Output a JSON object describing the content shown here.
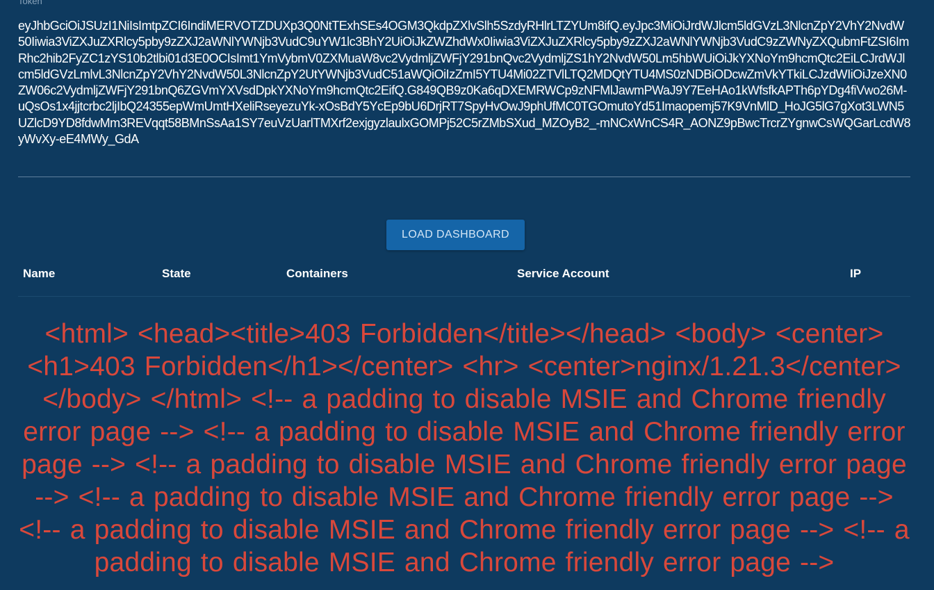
{
  "token": {
    "label": "Token",
    "value": "eyJhbGciOiJSUzI1NiIsImtpZCI6IndiMERVOTZDUXp3Q0NtTExhSEs4OGM3QkdpZXlvSlh5SzdyRHlrLTZYUm8ifQ.eyJpc3MiOiJrdWJlcm5ldGVzL3NlcnZpY2VhY2NvdW50Iiwia3ViZXJuZXRlcy5pby9zZXJ2aWNlYWNjb3VudC9uYW1lc3BhY2UiOiJkZWZhdWx0Iiwia3ViZXJuZXRlcy5pby9zZXJ2aWNlYWNjb3VudC9zZWNyZXQubmFtZSI6ImRhc2hib2FyZC1zYS10b2tlbi01d3E0OCIsImt1YmVybmV0ZXMuaW8vc2VydmljZWFjY291bnQvc2VydmljZS1hY2NvdW50Lm5hbWUiOiJkYXNoYm9hcmQtc2EiLCJrdWJlcm5ldGVzLmlvL3NlcnZpY2VhY2NvdW50L3NlcnZpY2UtYWNjb3VudC51aWQiOiIzZmI5YTU4Mi02ZTVlLTQ2MDQtYTU4MS0zNDBiODcwZmVkYTkiLCJzdWIiOiJzeXN0ZW06c2VydmljZWFjY291bnQ6ZGVmYXVsdDpkYXNoYm9hcmQtc2EifQ.G849QB9z0Ka6qDXEMRWCp9zNFMlJawmPWaJ9Y7EeHAo1kWfsfkAPTh6pYDg4fiVwo26M-uQsOs1x4jjtcrbc2ljIbQ24355epWmUmtHXeliRseyezuYk-xOsBdY5YcEp9bU6DrjRT7SpyHvOwJ9phUfMC0TGOmutoYd51Imaopemj57K9VnMlD_HoJG5lG7gXot3LWN5UZlcD9YD8fdwMm3REVqqt58BMnSsAa1SY7euVzUarlTMXrf2exjgyzlaulxGOMPj52C5rZMbSXud_MZOyB2_-mNCxWnCS4R_AONZ9pBwcTrcrZYgnwCsWQGarLcdW8yWvXy-eE4MWy_GdA"
  },
  "load_button": {
    "label": "LOAD DASHBOARD"
  },
  "table": {
    "columns": [
      "Name",
      "State",
      "Containers",
      "Service Account",
      "IP"
    ]
  },
  "error": {
    "text": "<html> <head><title>403 Forbidden</title></head> <body> <center><h1>403 Forbidden</h1></center> <hr> <center>nginx/1.21.3</center> </body> </html> <!-- a padding to disable MSIE and Chrome friendly error page --> <!-- a padding to disable MSIE and Chrome friendly error page --> <!-- a padding to disable MSIE and Chrome friendly error page --> <!-- a padding to disable MSIE and Chrome friendly error page --> <!-- a padding to disable MSIE and Chrome friendly error page --> <!-- a padding to disable MSIE and Chrome friendly error page -->",
    "color": "#d9483b"
  },
  "colors": {
    "background": "#0e3a5f",
    "button": "#1565a8",
    "text": "#ffffff"
  }
}
